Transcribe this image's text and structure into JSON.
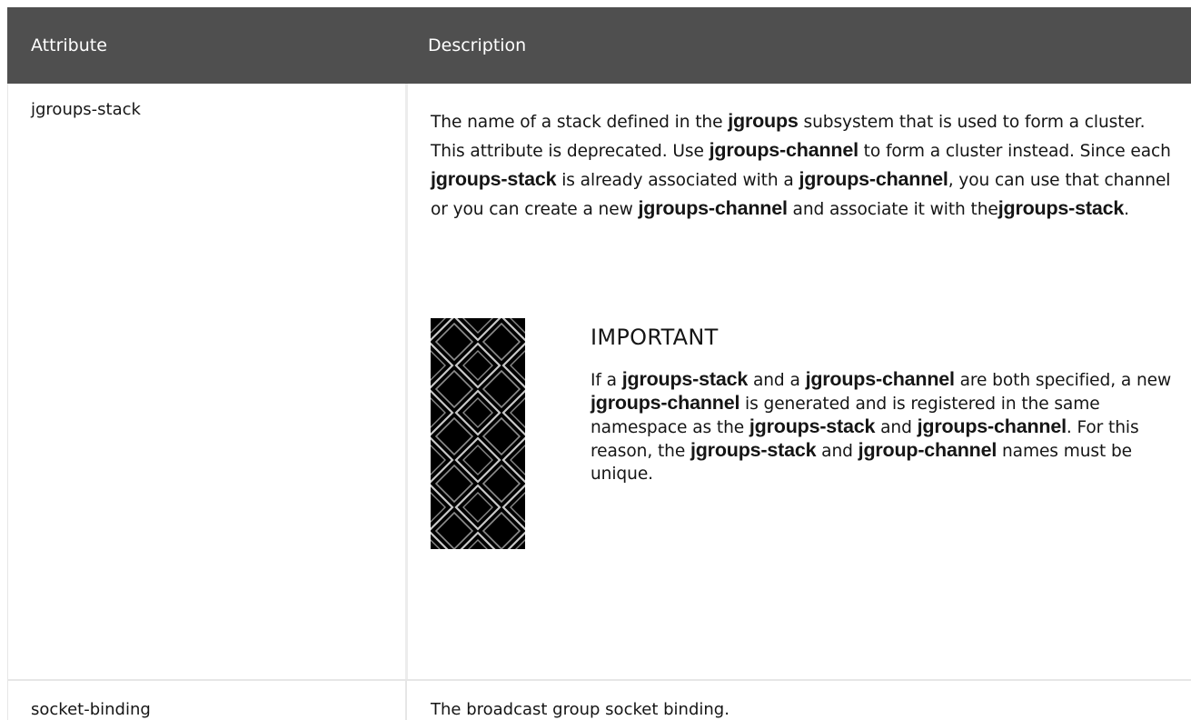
{
  "table": {
    "headers": {
      "attribute": "Attribute",
      "description": "Description"
    },
    "rows": [
      {
        "attribute": "jgroups-stack",
        "description": {
          "t1": "The name of a stack defined in the ",
          "c1": "jgroups",
          "t2": " subsystem that is used to form a cluster. This attribute is deprecated. Use ",
          "c2": "jgroups-channel",
          "t3": " to form a cluster instead. Since each ",
          "c3": "jgroups-stack",
          "t4": " is already associated with a ",
          "c4": "jgroups-channel",
          "t5": ", you can use that channel or you can create a new ",
          "c5": "jgroups-channel",
          "t6": " and associate it with the",
          "c6": "jgroups-stack",
          "t7": "."
        },
        "admonition": {
          "icon": "important-pattern-icon",
          "title": "IMPORTANT",
          "t1": "If a ",
          "c1": "jgroups-stack",
          "t2": " and a ",
          "c2": "jgroups-channel",
          "t3": " are both specified, a new ",
          "c3": "jgroups-channel",
          "t4": " is generated and is registered in the same namespace as the ",
          "c4": "jgroups-stack",
          "t5": " and ",
          "c5": "jgroups-channel",
          "t6": ". For this reason, the ",
          "c6": "jgroups-stack",
          "t7": " and ",
          "c7": "jgroup-channel",
          "t8": " names must be unique."
        }
      },
      {
        "attribute": "socket-binding",
        "description": "The broadcast group socket binding."
      }
    ]
  }
}
